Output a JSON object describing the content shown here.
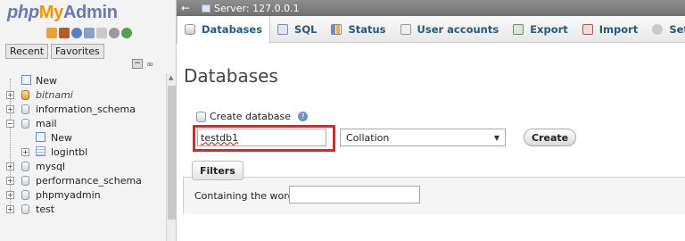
{
  "logo": {
    "php": "php",
    "my": "My",
    "admin": "Admin"
  },
  "nav_tabs": {
    "recent": "Recent",
    "favorites": "Favorites"
  },
  "tree": [
    {
      "label": "New",
      "type": "new"
    },
    {
      "label": "bitnami",
      "type": "db",
      "italic": true
    },
    {
      "label": "information_schema",
      "type": "db"
    },
    {
      "label": "mail",
      "type": "db"
    },
    {
      "label": "New",
      "type": "new-child"
    },
    {
      "label": "logintbl",
      "type": "table-child"
    },
    {
      "label": "mysql",
      "type": "db"
    },
    {
      "label": "performance_schema",
      "type": "db"
    },
    {
      "label": "phpmyadmin",
      "type": "db"
    },
    {
      "label": "test",
      "type": "db"
    }
  ],
  "topbar": {
    "server_label": "Server: 127.0.0.1"
  },
  "tabs": [
    {
      "label": "Databases",
      "icon": "database-icon",
      "active": true
    },
    {
      "label": "SQL",
      "icon": "sql-icon"
    },
    {
      "label": "Status",
      "icon": "status-icon"
    },
    {
      "label": "User accounts",
      "icon": "user-accounts-icon"
    },
    {
      "label": "Export",
      "icon": "export-icon"
    },
    {
      "label": "Import",
      "icon": "import-icon"
    },
    {
      "label": "Settings",
      "icon": "wrench-icon"
    }
  ],
  "main": {
    "title": "Databases",
    "create_db_label": "Create database",
    "db_name_value": "testdb1",
    "collation_selected": "Collation",
    "create_button": "Create",
    "filters_legend": "Filters",
    "containing_label": "Containing the word:",
    "containing_value": ""
  },
  "colors": {
    "highlight": "#d12b2f",
    "tab_text": "#235a81",
    "logo_blue": "#6c78af",
    "logo_orange": "#f29400"
  }
}
